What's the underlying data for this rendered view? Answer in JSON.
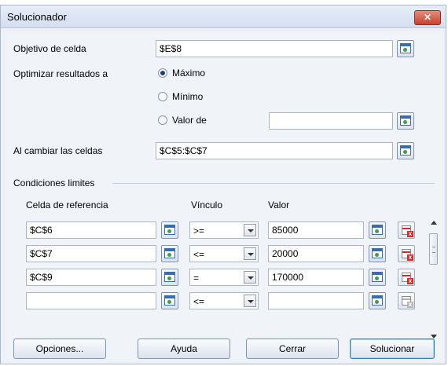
{
  "dialog": {
    "title": "Solucionador",
    "close_glyph": "✕"
  },
  "objective": {
    "label": "Objetivo de celda",
    "value": "$E$8"
  },
  "optimize": {
    "label": "Optimizar resultados a",
    "options": [
      {
        "label": "Máximo",
        "selected": true
      },
      {
        "label": "Mínimo",
        "selected": false
      },
      {
        "label": "Valor de",
        "selected": false
      }
    ],
    "value_of_field": ""
  },
  "changing_cells": {
    "label": "Al cambiar las celdas",
    "value": "$C$5:$C$7"
  },
  "constraints": {
    "group_label": "Condiciones limites",
    "headers": {
      "cell": "Celda de referencia",
      "link": "Vínculo",
      "value": "Valor"
    },
    "rows": [
      {
        "cell": "$C$6",
        "op": ">=",
        "value": "85000"
      },
      {
        "cell": "$C$7",
        "op": "<=",
        "value": "20000"
      },
      {
        "cell": "$C$9",
        "op": "=",
        "value": "170000"
      },
      {
        "cell": "",
        "op": "<=",
        "value": ""
      }
    ]
  },
  "buttons": {
    "options": "Opciones...",
    "help": "Ayuda",
    "close": "Cerrar",
    "solve": "Solucionar"
  },
  "icons": {
    "shrink": "shrink-dialog-icon",
    "delete": "delete-row-icon",
    "dropdown": "chevron-down-icon"
  },
  "colors": {
    "title_bar": "#dbe5f3",
    "close": "#c9412c",
    "default_button_border": "#3c7fb1"
  }
}
